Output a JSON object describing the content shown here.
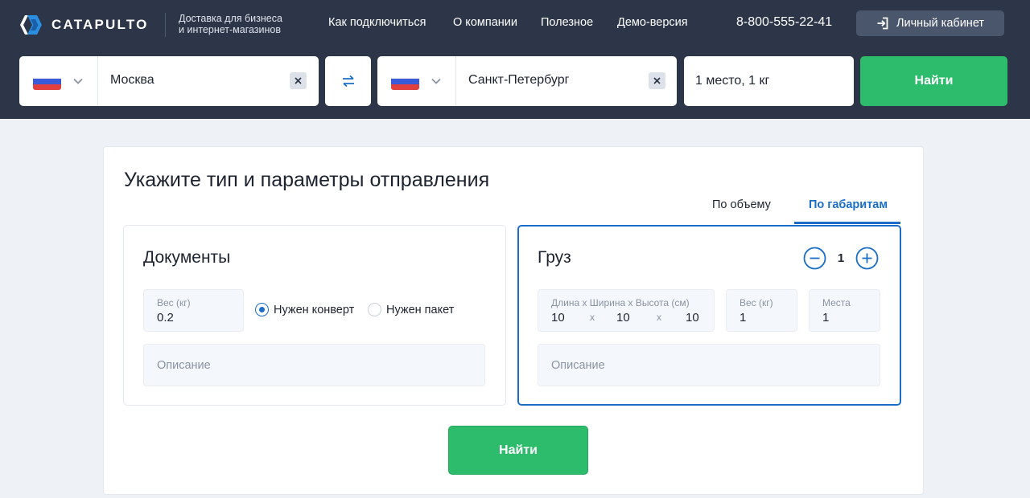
{
  "header": {
    "logo_text": "CATAPULTO",
    "tagline_line1": "Доставка для бизнеса",
    "tagline_line2": "и интернет-магазинов",
    "nav": [
      {
        "label": "Как подключиться"
      },
      {
        "label": "О компании"
      },
      {
        "label": "Полезное"
      },
      {
        "label": "Демо-версия"
      }
    ],
    "phone": "8-800-555-22-41",
    "cabinet_label": "Личный кабинет"
  },
  "search": {
    "from": {
      "city": "Москва",
      "flag_icon": "russia-flag-icon"
    },
    "to": {
      "city": "Санкт-Петербург",
      "flag_icon": "russia-flag-icon"
    },
    "places_summary": "1 место, 1 кг",
    "find_label": "Найти"
  },
  "shipment": {
    "title": "Укажите тип и параметры отправления",
    "tabs": [
      {
        "label": "По объему",
        "active": false
      },
      {
        "label": "По габаритам",
        "active": true
      }
    ],
    "documents": {
      "title": "Документы",
      "weight_label": "Вес (кг)",
      "weight_value": "0.2",
      "options": [
        {
          "label": "Нужен конверт",
          "selected": true
        },
        {
          "label": "Нужен пакет",
          "selected": false
        }
      ],
      "description_placeholder": "Описание"
    },
    "cargo": {
      "title": "Груз",
      "quantity": "1",
      "dims_label": "Длина x Ширина x Высота (см)",
      "length": "10",
      "width": "10",
      "height": "10",
      "separator": "x",
      "weight_label": "Вес (кг)",
      "weight_value": "1",
      "places_label": "Места",
      "places_value": "1",
      "description_placeholder": "Описание"
    },
    "find_label": "Найти"
  },
  "colors": {
    "header_bg": "#2c3648",
    "accent_blue": "#1a6ec7",
    "accent_green": "#2dbb6c",
    "page_bg": "#eef1f5"
  }
}
